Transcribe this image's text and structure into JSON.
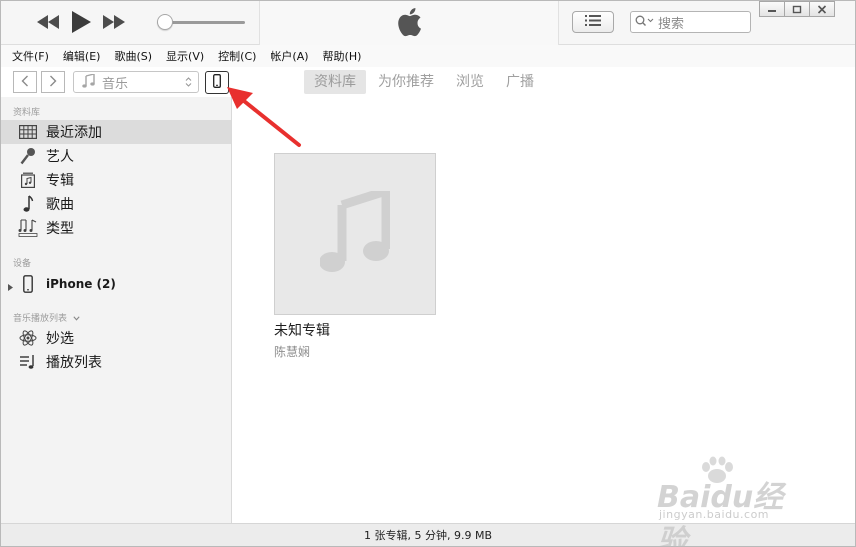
{
  "titlebar": {
    "search_placeholder": "搜索",
    "icons": [
      "rewind-icon",
      "play-icon",
      "fast-forward-icon",
      "apple-logo-icon",
      "list-view-icon",
      "search-icon",
      "minimize-icon",
      "restore-icon",
      "close-icon"
    ],
    "volume_level": 0.0
  },
  "menubar": {
    "items": [
      "文件(F)",
      "编辑(E)",
      "歌曲(S)",
      "显示(V)",
      "控制(C)",
      "帐户(A)",
      "帮助(H)"
    ]
  },
  "navbar": {
    "media_type": "音乐",
    "tabs": [
      "资料库",
      "为你推荐",
      "浏览",
      "广播"
    ],
    "active_tab": "资料库"
  },
  "sidebar": {
    "library_title": "资料库",
    "library_items": [
      "最近添加",
      "艺人",
      "专辑",
      "歌曲",
      "类型"
    ],
    "selected_item": "最近添加",
    "devices_title": "设备",
    "device_name": "iPhone (2)",
    "playlists_title": "音乐播放列表",
    "playlist_items": [
      "妙选",
      "播放列表"
    ]
  },
  "main": {
    "albums": [
      {
        "title": "未知专辑",
        "artist": "陈慧娴"
      }
    ]
  },
  "statusbar": {
    "text": "1 张专辑, 5 分钟, 9.9 MB"
  },
  "watermark": {
    "main": "Baidu经验",
    "sub": "jingyan.baidu.com"
  },
  "colors": {
    "annotation_arrow": "#e8302e",
    "selected_row": "#dcdcdc",
    "sidebar_bg": "#f3f3f3"
  }
}
